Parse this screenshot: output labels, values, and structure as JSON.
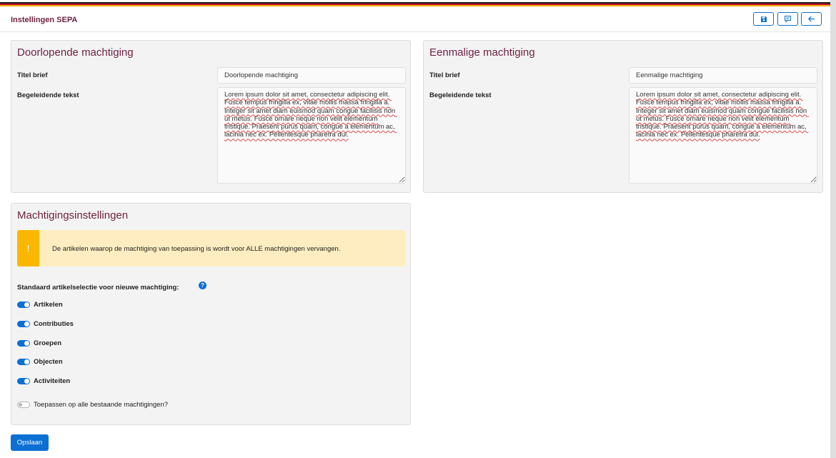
{
  "header": {
    "title": "Instellingen SEPA",
    "buttons": [
      {
        "icon": "save-icon"
      },
      {
        "icon": "comment-icon"
      },
      {
        "icon": "arrow-left-icon"
      }
    ]
  },
  "colors": {
    "accent": "#0b6fd4",
    "title": "#6e2240",
    "warning": "#fbb700",
    "warning_bg": "#fdedc0",
    "flag": [
      "#1a1a1a",
      "#c8102e",
      "#f2b100"
    ]
  },
  "doorlopend": {
    "title": "Doorlopende machtiging",
    "titel_brief_label": "Titel brief",
    "titel_brief_value": "Doorlopende machtiging",
    "tekst_label": "Begeleidende tekst",
    "tekst_value": "Lorem ipsum dolor sit amet, consectetur adipiscing elit. Fusce tempus fringilla ex, vitae mollis massa fringilla a. Integer sit amet diam euismod quam congue facilisis non ut metus. Fusce ornare neque non velit elementum tristique. Praesent purus quam, congue a elementum ac, lacinia nec ex. Pellentesque pharetra dui."
  },
  "eenmalig": {
    "title": "Eenmalige machtiging",
    "titel_brief_label": "Titel brief",
    "titel_brief_value": "Eenmalige machtiging",
    "tekst_label": "Begeleidende tekst",
    "tekst_value": "Lorem ipsum dolor sit amet, consectetur adipiscing elit. Fusce tempus fringilla ex, vitae mollis massa fringilla a. Integer sit amet diam euismod quam congue facilisis non ut metus. Fusce ornare neque non velit elementum tristique. Praesent purus quam, congue a elementum ac, lacinia nec ex. Pellentesque pharetra dui."
  },
  "instellingen": {
    "title": "Machtigingsinstellingen",
    "alert_icon": "!",
    "alert_text": "De artikelen waarop de machtiging van toepassing is wordt voor ALLE machtigingen vervangen.",
    "selectie_label": "Standaard artikelselectie voor nieuwe machtiging:",
    "help_icon": "?",
    "toggles": [
      {
        "label": "Artikelen",
        "on": true
      },
      {
        "label": "Contributies",
        "on": true
      },
      {
        "label": "Groepen",
        "on": true
      },
      {
        "label": "Objecten",
        "on": true
      },
      {
        "label": "Activiteiten",
        "on": true
      }
    ],
    "apply_label": "Toepassen op alle bestaande machtigingen?",
    "apply_on": false
  },
  "footer": {
    "save_label": "Opslaan"
  }
}
